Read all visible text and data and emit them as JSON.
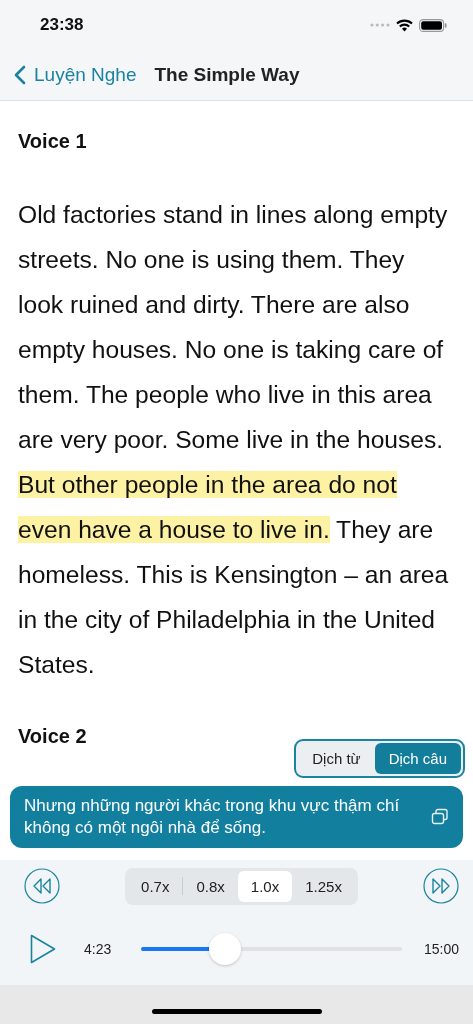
{
  "status_bar": {
    "time": "23:38"
  },
  "nav": {
    "back_label": "Luyện Nghe",
    "title": "The Simple Way"
  },
  "sections": [
    {
      "heading": "Voice 1",
      "segments": [
        {
          "text": "Old factories stand in lines along empty streets. No one is using them. They look ruined and dirty. There are also empty houses. No one is taking care of them. The people who live in this area are very poor. Some live in the houses. ",
          "highlighted": false
        },
        {
          "text": "But other people in the area do not even have a house to live in.",
          "highlighted": true
        },
        {
          "text": " They are homeless. This is Kensington – an area in the city of Philadelphia in the United States.",
          "highlighted": false
        }
      ]
    },
    {
      "heading": "Voice 2"
    }
  ],
  "translate_modes": [
    {
      "label": "Dịch từ",
      "selected": false
    },
    {
      "label": "Dịch câu",
      "selected": true
    }
  ],
  "translation": {
    "text": "Nhưng những người khác trong khu vực thậm chí không có một ngôi nhà để sống."
  },
  "speeds": [
    {
      "label": "0.7x",
      "selected": false
    },
    {
      "label": "0.8x",
      "selected": false
    },
    {
      "label": "1.0x",
      "selected": true
    },
    {
      "label": "1.25x",
      "selected": false
    }
  ],
  "player": {
    "elapsed": "4:23",
    "total": "15:00",
    "level": 0.32
  }
}
